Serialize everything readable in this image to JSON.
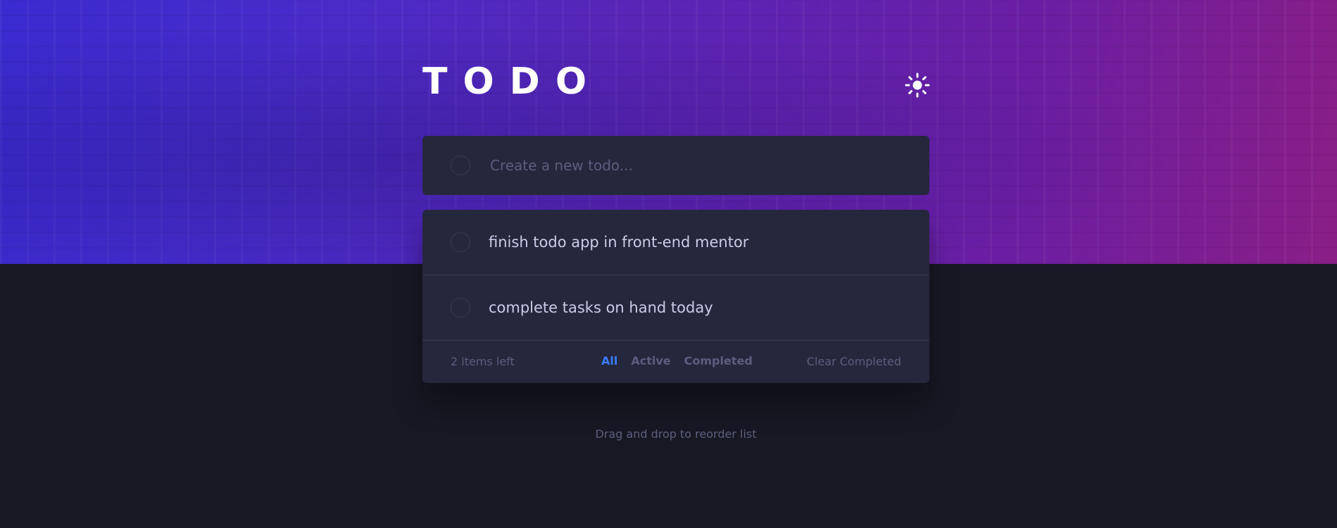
{
  "header": {
    "title": "TODO",
    "theme_toggle_icon": "sun-icon"
  },
  "create": {
    "placeholder": "Create a new todo..."
  },
  "todos": [
    {
      "text": "finish todo app in front-end mentor",
      "completed": false
    },
    {
      "text": "complete tasks on hand today",
      "completed": false
    }
  ],
  "footer": {
    "items_left": "2 items left",
    "filters": [
      "All",
      "Active",
      "Completed"
    ],
    "active_filter": "All",
    "clear_label": "Clear Completed"
  },
  "hint": "Drag and drop to reorder list",
  "colors": {
    "background": "#181824",
    "card": "#25273c",
    "accent": "#3a7cfd",
    "muted": "#5b5e7e",
    "text": "#cacde8"
  }
}
